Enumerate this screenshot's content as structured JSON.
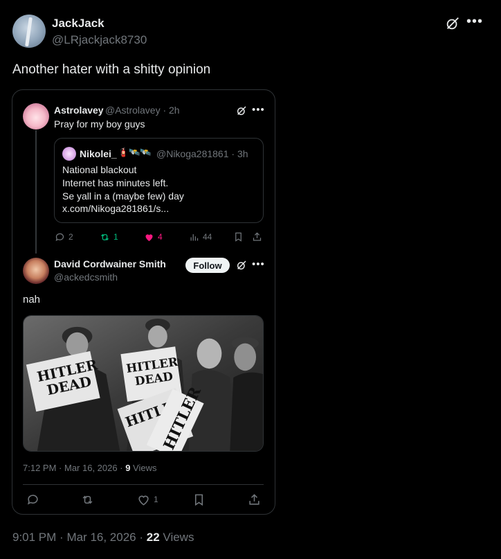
{
  "outer": {
    "name": "JackJack",
    "handle": "@LRjackjack8730",
    "text": "Another hater with a shitty opinion",
    "time": "9:01 PM",
    "date": "Mar 16, 2026",
    "views_count": "22",
    "views_label": "Views"
  },
  "astro": {
    "name": "Astrolavey",
    "handle": "@Astrolavey · 2h",
    "text": "Pray for my boy guys",
    "quote": {
      "name": "Nikolei_",
      "emojis": "🧯🛰️🛰️",
      "handle": "@Nikoga281861 · 3h",
      "lines": [
        "National blackout",
        "Internet has minutes left.",
        "Se yall in a (maybe few) day",
        "x.com/Nikoga281861/s..."
      ]
    },
    "metrics": {
      "replies": "2",
      "reposts": "1",
      "likes": "4",
      "views": "44"
    }
  },
  "david": {
    "name": "David Cordwainer Smith",
    "handle": "@ackedcsmith",
    "follow_label": "Follow",
    "text": "nah",
    "photo_headline": "HITLER DEAD",
    "time": "7:12 PM",
    "date": "Mar 16, 2026",
    "views_count": "9",
    "views_label": "Views",
    "likes": "1"
  },
  "colors": {
    "accent_pink": "#f91880",
    "accent_green": "#00ba7c",
    "muted": "#71767b",
    "border": "#2f3336"
  }
}
